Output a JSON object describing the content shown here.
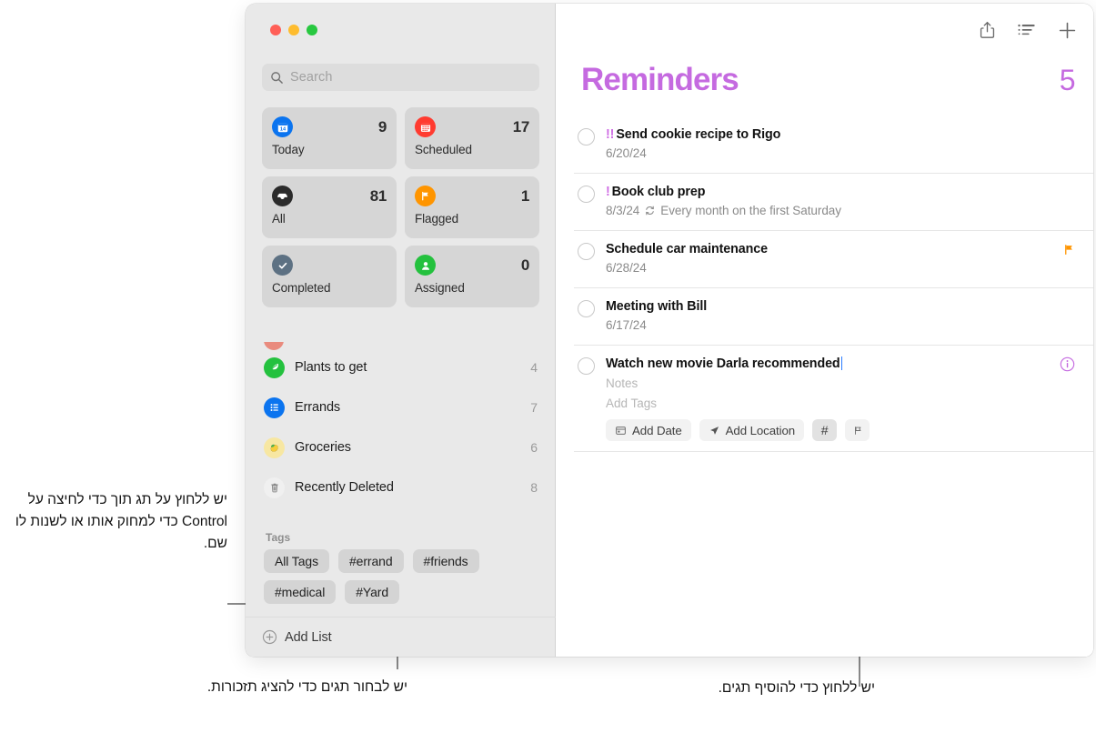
{
  "window": {
    "traffic_lights": [
      "close",
      "minimize",
      "zoom"
    ],
    "colors": {
      "close": "#ff5f57",
      "minimize": "#febc2e",
      "zoom": "#28c840",
      "accent": "#c56ae0",
      "flag": "#ff9500",
      "caret": "#2b7cff"
    }
  },
  "sidebar": {
    "search": {
      "placeholder": "Search",
      "icon": "search-icon"
    },
    "smart_lists": [
      {
        "label": "Today",
        "count": "9",
        "icon": "calendar-day-icon",
        "color": "#0b74ef"
      },
      {
        "label": "Scheduled",
        "count": "17",
        "icon": "calendar-icon",
        "color": "#ff3b30"
      },
      {
        "label": "All",
        "count": "81",
        "icon": "inbox-tray-icon",
        "color": "#2b2b2b"
      },
      {
        "label": "Flagged",
        "count": "1",
        "icon": "flag-icon",
        "color": "#ff9500"
      },
      {
        "label": "Completed",
        "count": "",
        "icon": "checkmark-icon",
        "color": "#5d7183"
      },
      {
        "label": "Assigned",
        "count": "0",
        "icon": "person-icon",
        "color": "#24c13e"
      }
    ],
    "lists": [
      {
        "name": "Plants to get",
        "count": "4",
        "icon": "leaf-icon",
        "color": "#24c13e"
      },
      {
        "name": "Errands",
        "count": "7",
        "icon": "list-icon",
        "color": "#0b74ef"
      },
      {
        "name": "Groceries",
        "count": "6",
        "icon": "lemon-icon",
        "color": "#f5e08a"
      },
      {
        "name": "Recently Deleted",
        "count": "8",
        "icon": "trash-icon",
        "color": "#f2f2f2"
      }
    ],
    "tags_header": "Tags",
    "tags": [
      "All Tags",
      "#errand",
      "#friends",
      "#medical",
      "#Yard"
    ],
    "add_list": {
      "label": "Add List",
      "icon": "plus-circle-icon"
    }
  },
  "main": {
    "toolbar": [
      {
        "name": "share-icon",
        "label": "Share"
      },
      {
        "name": "sort-list-icon",
        "label": "List Options"
      },
      {
        "name": "plus-icon",
        "label": "New Reminder"
      }
    ],
    "title": "Reminders",
    "count": "5",
    "reminders": [
      {
        "priority": "!!",
        "title": "Send cookie recipe to Rigo",
        "date": "6/20/24",
        "repeat": "",
        "flagged": false,
        "editing": false
      },
      {
        "priority": "!",
        "title": "Book club prep",
        "date": "8/3/24",
        "repeat": "Every month on the first Saturday",
        "flagged": false,
        "editing": false
      },
      {
        "priority": "",
        "title": "Schedule car maintenance",
        "date": "6/28/24",
        "repeat": "",
        "flagged": true,
        "editing": false
      },
      {
        "priority": "",
        "title": "Meeting with Bill",
        "date": "6/17/24",
        "repeat": "",
        "flagged": false,
        "editing": false
      },
      {
        "priority": "",
        "title": "Watch new movie Darla recommended",
        "date": "",
        "repeat": "",
        "flagged": false,
        "editing": true,
        "notes_placeholder": "Notes",
        "tags_placeholder": "Add Tags",
        "chips": [
          {
            "label": "Add Date",
            "icon": "calendar-small-icon",
            "highlighted": false
          },
          {
            "label": "Add Location",
            "icon": "location-arrow-icon",
            "highlighted": false
          },
          {
            "label": "#",
            "icon": "hash-icon",
            "highlighted": true
          },
          {
            "label": "",
            "icon": "flag-outline-icon",
            "highlighted": false
          }
        ],
        "info_icon": "info-circle-icon"
      }
    ]
  },
  "annotations": {
    "left": "יש ללחוץ על תג תוך כדי לחיצה על Control כדי למחוק אותו או לשנות לו שם.",
    "bottom_left": "יש לבחור תגים כדי להציג תזכורות.",
    "bottom_right": "יש ללחוץ כדי להוסיף תגים."
  }
}
